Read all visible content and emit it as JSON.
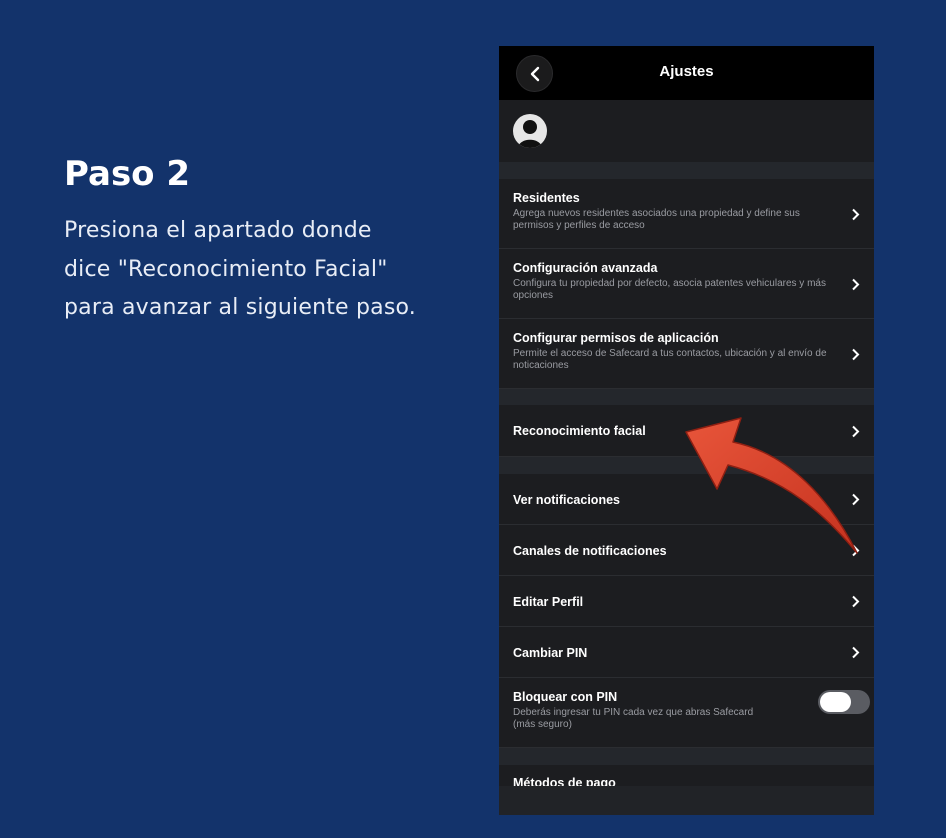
{
  "step": {
    "title": "Paso 2",
    "lines": [
      "Presiona el apartado donde",
      "dice \"Reconocimiento Facial\"",
      "para avanzar al siguiente paso."
    ]
  },
  "app": {
    "header_title": "Ajustes",
    "rows": {
      "residentes": {
        "title": "Residentes",
        "subtitle": "Agrega nuevos residentes asociados una propiedad y define sus permisos y perfiles de acceso"
      },
      "config_avanzada": {
        "title": "Configuración avanzada",
        "subtitle": "Configura tu propiedad por defecto, asocia patentes vehiculares y más opciones"
      },
      "permisos": {
        "title": "Configurar permisos de aplicación",
        "subtitle": "Permite el acceso de Safecard a tus contactos, ubicación y al envío de noticaciones"
      },
      "reconocimiento": {
        "title": "Reconocimiento facial"
      },
      "ver_notificaciones": {
        "title": "Ver notificaciones"
      },
      "canales": {
        "title": "Canales de notificaciones"
      },
      "editar_perfil": {
        "title": "Editar Perfil"
      },
      "cambiar_pin": {
        "title": "Cambiar PIN"
      },
      "bloquear_pin": {
        "title": "Bloquear con PIN",
        "subtitle": "Deberás ingresar tu PIN cada vez que abras Safecard (más seguro)",
        "toggle_on": false
      },
      "metodos_pago": {
        "title": "Métodos de pago"
      }
    }
  },
  "colors": {
    "background": "#13336b",
    "phone": "#1c1d20",
    "arrow": "#d9402a"
  },
  "icons": {
    "back": "back-arrow-icon",
    "chevron": "chevron-right-icon",
    "avatar": "user-silhouette-icon",
    "pointer": "curved-arrow-icon"
  }
}
